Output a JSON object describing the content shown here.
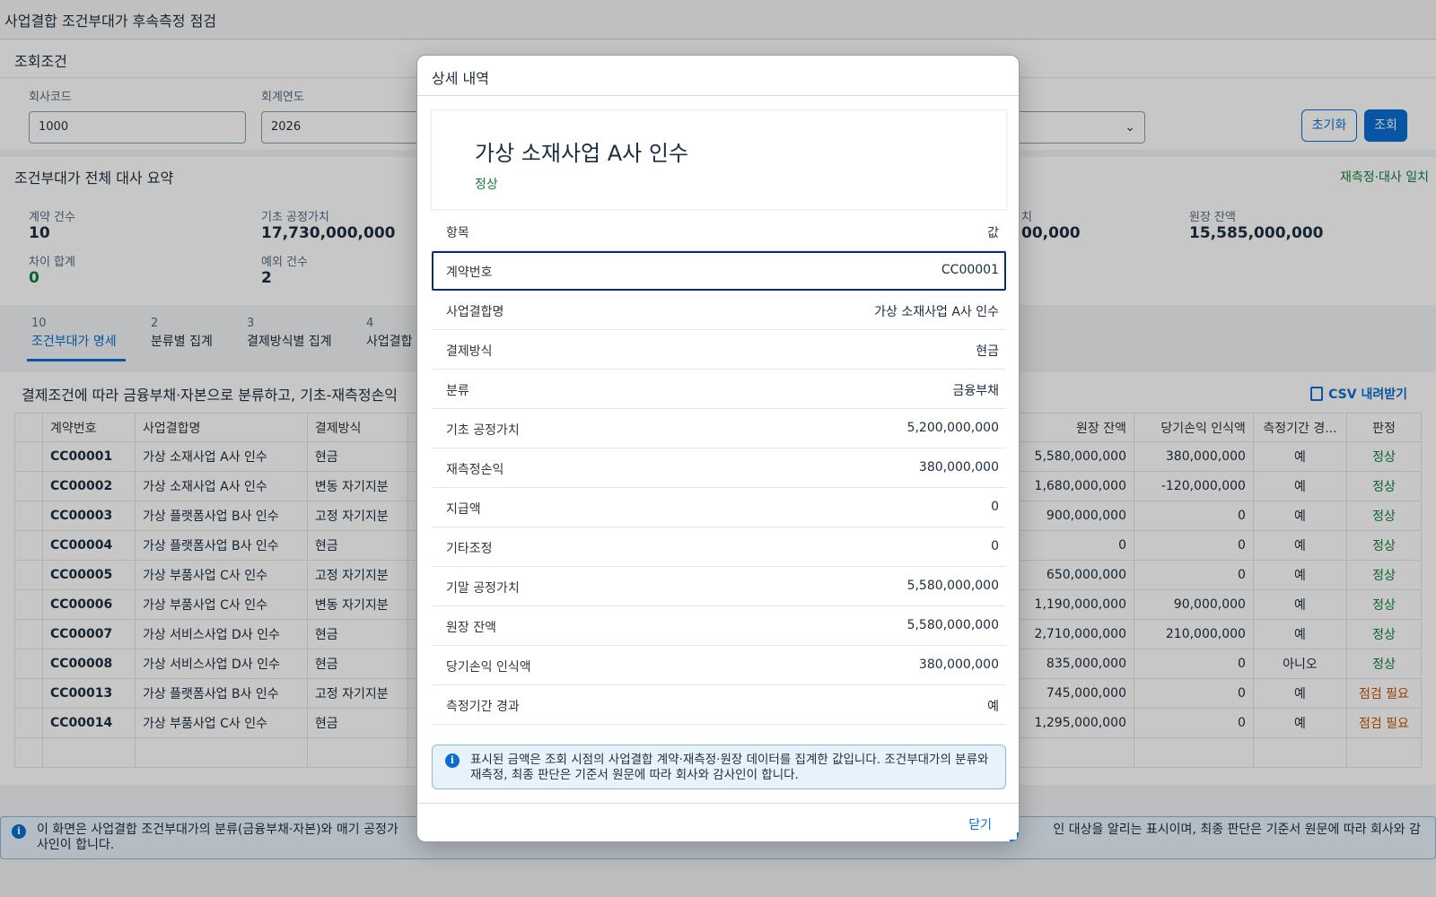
{
  "page_title": "사업결합 조건부대가 후속측정 점검",
  "filter": {
    "header": "조회조건",
    "company_code_label": "회사코드",
    "company_code_value": "1000",
    "fiscal_year_label": "회계연도",
    "fiscal_year_value": "2026",
    "reset_label": "초기화",
    "search_label": "조회"
  },
  "summary": {
    "title": "조건부대가 전체 대사 요약",
    "status": "재측정·대사 일치",
    "kpis": [
      {
        "label": "계약 건수",
        "value": "10"
      },
      {
        "label": "기초 공정가치",
        "value": "17,730,000,000"
      },
      {
        "label": "차이 합계",
        "value": "0"
      },
      {
        "label": "예외 건수",
        "value": "2"
      },
      {
        "label": "치",
        "value": "00,000"
      },
      {
        "label": "원장 잔액",
        "value": "15,585,000,000"
      }
    ]
  },
  "tabs": [
    {
      "count": "10",
      "label": "조건부대가 명세"
    },
    {
      "count": "2",
      "label": "분류별 집계"
    },
    {
      "count": "3",
      "label": "결제방식별 집계"
    },
    {
      "count": "4",
      "label": "사업결합"
    }
  ],
  "table": {
    "caption": "결제조건에 따라 금융부채·자본으로 분류하고, 기초-재측정손익",
    "csv_label": "CSV 내려받기",
    "left_headers": [
      "계약번호",
      "사업결합명",
      "결제방식"
    ],
    "right_headers": [
      "원장 잔액",
      "당기손익 인식액",
      "측정기간 경...",
      "판정"
    ],
    "rows": [
      {
        "id": "CC00001",
        "name": "가상 소재사업 A사 인수",
        "method": "현금",
        "ledger": "5,580,000,000",
        "pl": "380,000,000",
        "period": "예",
        "verdict": "정상"
      },
      {
        "id": "CC00002",
        "name": "가상 소재사업 A사 인수",
        "method": "변동 자기지분",
        "ledger": "1,680,000,000",
        "pl": "-120,000,000",
        "period": "예",
        "verdict": "정상"
      },
      {
        "id": "CC00003",
        "name": "가상 플랫폼사업 B사 인수",
        "method": "고정 자기지분",
        "ledger": "900,000,000",
        "pl": "0",
        "period": "예",
        "verdict": "정상"
      },
      {
        "id": "CC00004",
        "name": "가상 플랫폼사업 B사 인수",
        "method": "현금",
        "ledger": "0",
        "pl": "0",
        "period": "예",
        "verdict": "정상"
      },
      {
        "id": "CC00005",
        "name": "가상 부품사업 C사 인수",
        "method": "고정 자기지분",
        "ledger": "650,000,000",
        "pl": "0",
        "period": "예",
        "verdict": "정상"
      },
      {
        "id": "CC00006",
        "name": "가상 부품사업 C사 인수",
        "method": "변동 자기지분",
        "ledger": "1,190,000,000",
        "pl": "90,000,000",
        "period": "예",
        "verdict": "정상"
      },
      {
        "id": "CC00007",
        "name": "가상 서비스사업 D사 인수",
        "method": "현금",
        "ledger": "2,710,000,000",
        "pl": "210,000,000",
        "period": "예",
        "verdict": "정상"
      },
      {
        "id": "CC00008",
        "name": "가상 서비스사업 D사 인수",
        "method": "현금",
        "ledger": "835,000,000",
        "pl": "0",
        "period": "아니오",
        "verdict": "정상"
      },
      {
        "id": "CC00013",
        "name": "가상 플랫폼사업 B사 인수",
        "method": "고정 자기지분",
        "ledger": "745,000,000",
        "pl": "0",
        "period": "예",
        "verdict": "점검 필요"
      },
      {
        "id": "CC00014",
        "name": "가상 부품사업 C사 인수",
        "method": "현금",
        "ledger": "1,295,000,000",
        "pl": "0",
        "period": "예",
        "verdict": "점검 필요"
      }
    ]
  },
  "footer_note": {
    "left": "이 화면은 사업결합 조건부대가의 분류(금융부채·자본)와 매기 공정가",
    "right_line1": "인 대상을 알리는 표시이며, 최종 판단은 기준서 원문에 따라 회사와 감",
    "line2": "사인이 합니다."
  },
  "dialog": {
    "title": "상세 내역",
    "hero_title": "가상 소재사업 A사 인수",
    "hero_status": "정상",
    "col_item": "항목",
    "col_value": "값",
    "rows": [
      {
        "label": "계약번호",
        "value": "CC00001"
      },
      {
        "label": "사업결합명",
        "value": "가상 소재사업 A사 인수"
      },
      {
        "label": "결제방식",
        "value": "현금"
      },
      {
        "label": "분류",
        "value": "금융부채"
      },
      {
        "label": "기초 공정가치",
        "value": "5,200,000,000"
      },
      {
        "label": "재측정손익",
        "value": "380,000,000"
      },
      {
        "label": "지급액",
        "value": "0"
      },
      {
        "label": "기타조정",
        "value": "0"
      },
      {
        "label": "기말 공정가치",
        "value": "5,580,000,000"
      },
      {
        "label": "원장 잔액",
        "value": "5,580,000,000"
      },
      {
        "label": "당기손익 인식액",
        "value": "380,000,000"
      },
      {
        "label": "측정기간 경과",
        "value": "예"
      }
    ],
    "note": "표시된 금액은 조회 시점의 사업결합 계약·재측정·원장 데이터를 집계한 값입니다. 조건부대가의 분류와 재측정, 최종 판단은 기준서 원문에 따라 회사와 감사인이 합니다.",
    "close_label": "닫기"
  },
  "colors": {
    "accent": "#0a6ed1",
    "ok": "#107e3e",
    "warn": "#c35500",
    "selected_border": "#0b2e73"
  }
}
